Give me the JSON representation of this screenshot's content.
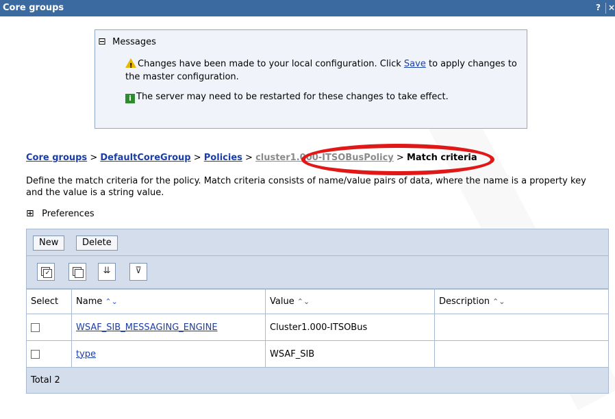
{
  "window": {
    "title": "Core groups",
    "help_label": "?",
    "close_label": "×"
  },
  "messages": {
    "header": "Messages",
    "collapse_symbol": "⊟",
    "warning": {
      "icon": "warning-icon",
      "text_before": "Changes have been made to your local configuration. Click ",
      "link": "Save",
      "text_after": " to apply changes to the master configuration."
    },
    "info": {
      "icon": "info-icon",
      "text": "The server may need to be restarted for these changes to take effect."
    }
  },
  "breadcrumb": {
    "items": [
      "Core groups",
      "DefaultCoreGroup",
      "Policies",
      "cluster1.000-ITSOBusPolicy"
    ],
    "separator": ">",
    "current": "Match criteria",
    "highlight_color": "#e01818"
  },
  "description": "Define the match criteria for the policy. Match criteria consists of name/value pairs of data, where the name is a property key and the value is a string value.",
  "preferences": {
    "label": "Preferences",
    "expand_symbol": "⊞"
  },
  "toolbar": {
    "new_label": "New",
    "delete_label": "Delete",
    "icons": [
      "select-all-icon",
      "deselect-all-icon",
      "show-filter-icon",
      "clear-filter-icon"
    ]
  },
  "table": {
    "columns": [
      "Select",
      "Name",
      "Value",
      "Description"
    ],
    "sort_symbol": "⌃⌄",
    "rows": [
      {
        "name": "WSAF_SIB_MESSAGING_ENGINE",
        "value": "Cluster1.000-ITSOBus",
        "description": ""
      },
      {
        "name": "type",
        "value": "WSAF_SIB",
        "description": ""
      }
    ],
    "total_label": "Total 2"
  },
  "colors": {
    "title_bar": "#3b6aa0",
    "link": "#1a3ea8",
    "panel": "#d3ddec"
  }
}
